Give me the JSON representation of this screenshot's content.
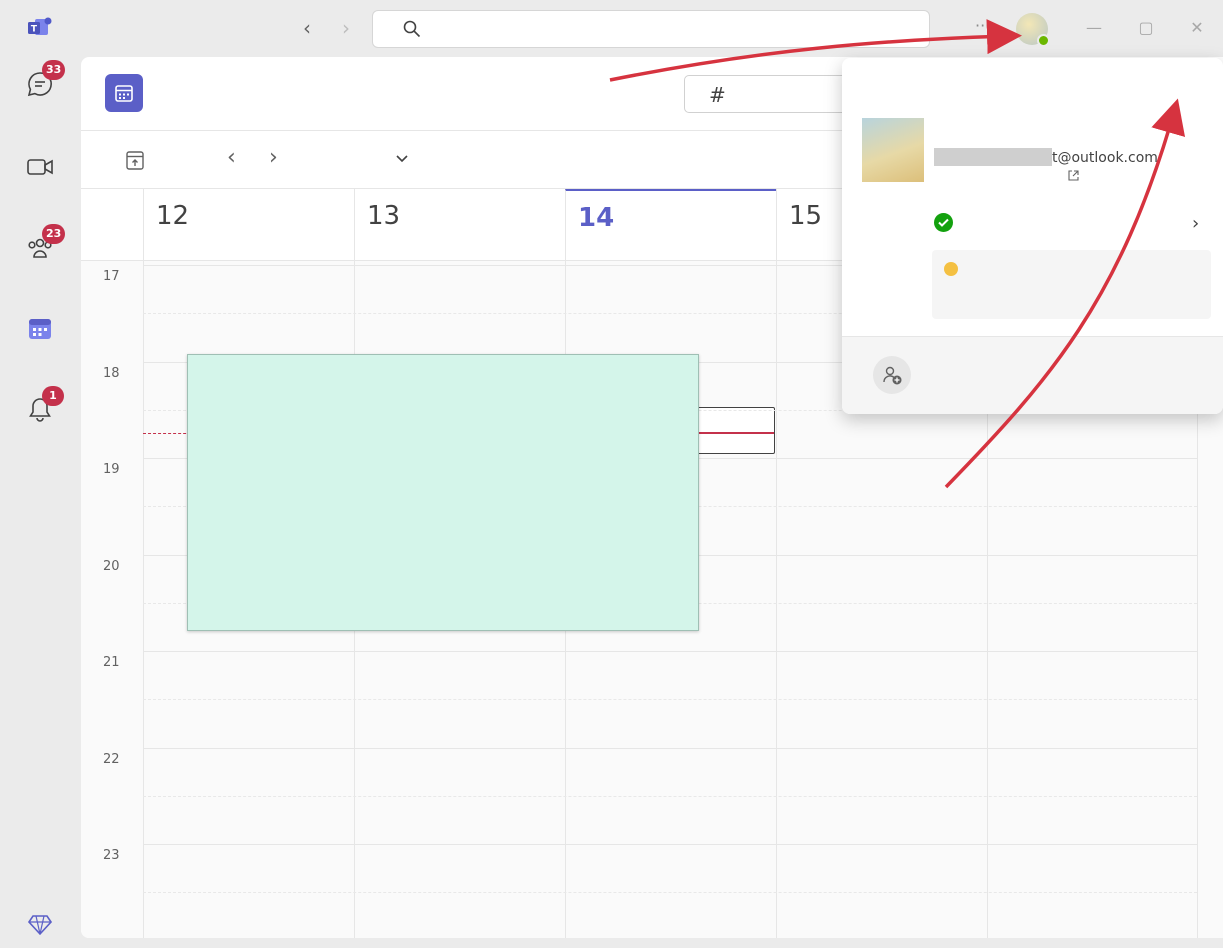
{
  "search": {
    "placeholder": ""
  },
  "rail": [
    {
      "label": "",
      "badge": "33"
    },
    {
      "label": "",
      "badge": ""
    },
    {
      "label": "",
      "badge": "23"
    },
    {
      "label": "",
      "badge": ""
    },
    {
      "label": "",
      "badge": "1"
    }
  ],
  "header": {
    "title": "",
    "join_label": ""
  },
  "toolbar": {
    "today_label": "",
    "month_label": ""
  },
  "days": [
    {
      "num": "12",
      "name": ""
    },
    {
      "num": "13",
      "name": ""
    },
    {
      "num": "14",
      "name": ""
    },
    {
      "num": "15",
      "name": ""
    }
  ],
  "hours": [
    "17",
    "18",
    "19",
    "20",
    "21",
    "22",
    "23"
  ],
  "callout": {
    "lines": [
      "",
      "",
      ""
    ]
  },
  "account": {
    "heading": "",
    "sign_out": "",
    "name": "",
    "email": "t@outlook.com",
    "ms_account_link": "",
    "status": "",
    "add_account": ""
  },
  "annotations": {
    "step1": "",
    "step2": "",
    "step2_note": ""
  },
  "colors": {
    "accent": "#5b5fc7",
    "badge": "#c4314b",
    "annotation": "#d6333f",
    "callout_bg": "#d4f5ea",
    "available": "#13a10e"
  }
}
